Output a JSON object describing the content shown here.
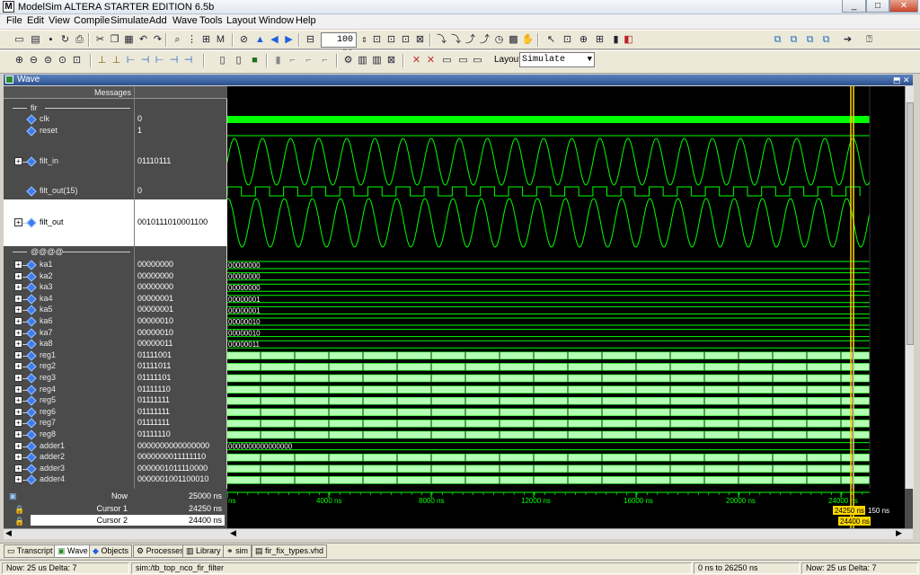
{
  "app": {
    "title": "ModelSim ALTERA STARTER EDITION 6.5b",
    "logo_letter": "M"
  },
  "window_controls": [
    "_",
    "□",
    "✕"
  ],
  "menu": [
    "File",
    "Edit",
    "View",
    "Compile",
    "Simulate",
    "Add",
    "Wave",
    "Tools",
    "Layout",
    "Window",
    "Help"
  ],
  "toolbar": {
    "run_length": "100 ns",
    "layout_label": "Layout",
    "layout_value": "Simulate"
  },
  "wave_window": {
    "title": "Wave",
    "header_messages": "Messages"
  },
  "groups": [
    {
      "name": "fir"
    },
    {
      "name": "@@@@"
    }
  ],
  "signals": [
    {
      "name": "clk",
      "value": "0",
      "expand": false
    },
    {
      "name": "reset",
      "value": "1",
      "expand": false
    },
    {
      "name": "filt_in",
      "value": "01110111",
      "expand": true
    },
    {
      "name": "filt_out(15)",
      "value": "0",
      "expand": false
    },
    {
      "name": "filt_out",
      "value": "0010111010001100",
      "expand": true
    }
  ],
  "bus_signals": [
    {
      "name": "ka1",
      "value": "00000000",
      "wave_label": "00000000"
    },
    {
      "name": "ka2",
      "value": "00000000",
      "wave_label": "00000000"
    },
    {
      "name": "ka3",
      "value": "00000000",
      "wave_label": "00000000"
    },
    {
      "name": "ka4",
      "value": "00000001",
      "wave_label": "00000001"
    },
    {
      "name": "ka5",
      "value": "00000001",
      "wave_label": "00000001"
    },
    {
      "name": "ka6",
      "value": "00000010",
      "wave_label": "00000010"
    },
    {
      "name": "ka7",
      "value": "00000010",
      "wave_label": "00000010"
    },
    {
      "name": "ka8",
      "value": "00000011",
      "wave_label": "00000011"
    },
    {
      "name": "reg1",
      "value": "01111001",
      "wave_label": ""
    },
    {
      "name": "reg2",
      "value": "01111011",
      "wave_label": ""
    },
    {
      "name": "reg3",
      "value": "01111101",
      "wave_label": ""
    },
    {
      "name": "reg4",
      "value": "01111110",
      "wave_label": ""
    },
    {
      "name": "reg5",
      "value": "01111111",
      "wave_label": ""
    },
    {
      "name": "reg6",
      "value": "01111111",
      "wave_label": ""
    },
    {
      "name": "reg7",
      "value": "01111111",
      "wave_label": ""
    },
    {
      "name": "reg8",
      "value": "01111110",
      "wave_label": ""
    },
    {
      "name": "adder1",
      "value": "0000000000000000",
      "wave_label": "0000000000000000"
    },
    {
      "name": "adder2",
      "value": "0000000011111110",
      "wave_label": ""
    },
    {
      "name": "adder3",
      "value": "0000001011110000",
      "wave_label": ""
    },
    {
      "name": "adder4",
      "value": "0000001001100010",
      "wave_label": ""
    }
  ],
  "cursors": [
    {
      "name": "Now",
      "value": "25000 ns"
    },
    {
      "name": "Cursor 1",
      "value": "24250 ns"
    },
    {
      "name": "Cursor 2",
      "value": "24400 ns"
    }
  ],
  "timeline": {
    "ticks": [
      "ns",
      "4000 ns",
      "8000 ns",
      "12000 ns",
      "16000 ns",
      "20000 ns",
      "24000 ns"
    ],
    "cursor1_label": "24250 ns",
    "cursor2_label": "24400 ns",
    "delta_label": "150 ns"
  },
  "tabs": [
    {
      "label": "Transcript",
      "active": false
    },
    {
      "label": "Wave",
      "active": true
    },
    {
      "label": "Objects",
      "active": false
    },
    {
      "label": "Processes",
      "active": false
    },
    {
      "label": "Library",
      "active": false
    },
    {
      "label": "sim",
      "active": false
    },
    {
      "label": "fir_fix_types.vhd",
      "active": false
    }
  ],
  "status": {
    "left": "Now: 25 us  Delta: 7",
    "context": "sim:/tb_top_nco_fir_filter",
    "range": "0 ns to 26250 ns",
    "right": "Now: 25 us  Delta: 7"
  },
  "colors": {
    "wave_green": "#00ff00",
    "bus_fill": "#b3ffb3",
    "cursor_yellow": "#ffd700",
    "cursor_white": "#ffffff"
  }
}
